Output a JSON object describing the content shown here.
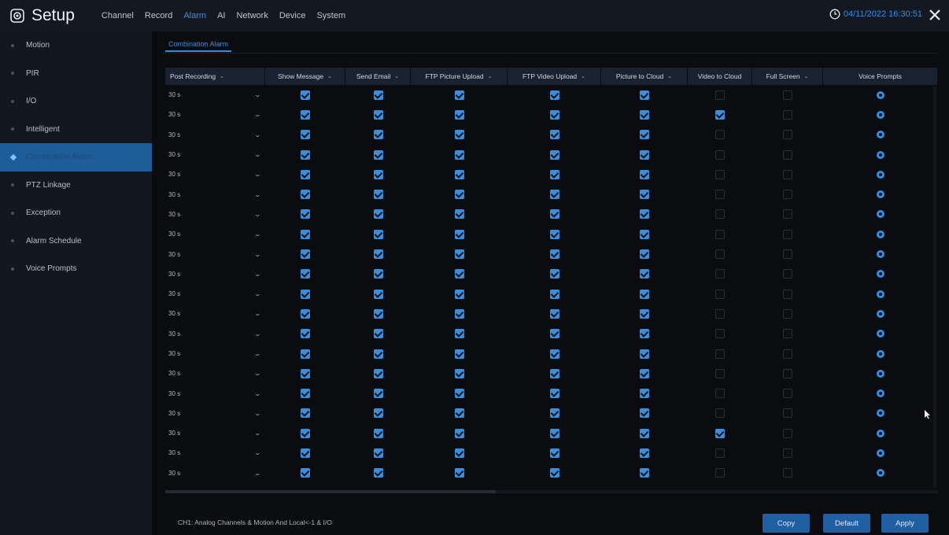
{
  "app": {
    "title": "Setup",
    "datetime": "04/11/2022 16:30:51"
  },
  "menu": [
    {
      "label": "Channel",
      "active": false
    },
    {
      "label": "Record",
      "active": false
    },
    {
      "label": "Alarm",
      "active": true
    },
    {
      "label": "AI",
      "active": false
    },
    {
      "label": "Network",
      "active": false
    },
    {
      "label": "Device",
      "active": false
    },
    {
      "label": "System",
      "active": false
    }
  ],
  "sidebar": {
    "items": [
      {
        "label": "Motion",
        "active": false
      },
      {
        "label": "PIR",
        "active": false
      },
      {
        "label": "I/O",
        "active": false
      },
      {
        "label": "Intelligent",
        "active": false
      },
      {
        "label": "Combination Alarm",
        "active": true
      },
      {
        "label": "PTZ Linkage",
        "active": false
      },
      {
        "label": "Exception",
        "active": false
      },
      {
        "label": "Alarm Schedule",
        "active": false
      },
      {
        "label": "Voice Prompts",
        "active": false
      }
    ]
  },
  "subtab": {
    "label": "Combination Alarm"
  },
  "table": {
    "headers": [
      {
        "label": "Post Recording",
        "caret": true
      },
      {
        "label": "Show Message",
        "caret": true
      },
      {
        "label": "Send Email",
        "caret": true
      },
      {
        "label": "FTP Picture Upload",
        "caret": true
      },
      {
        "label": "FTP Video Upload",
        "caret": true
      },
      {
        "label": "Picture to Cloud",
        "caret": true
      },
      {
        "label": "Video to Cloud",
        "caret": false
      },
      {
        "label": "Full Screen",
        "caret": true
      },
      {
        "label": "Voice Prompts",
        "caret": false
      }
    ],
    "rows": [
      {
        "post": "30 s",
        "show": true,
        "email": true,
        "ftp_pic": true,
        "ftp_vid": true,
        "pic_cloud": true,
        "vid_cloud": false,
        "full": false
      },
      {
        "post": "30 s",
        "show": true,
        "email": true,
        "ftp_pic": true,
        "ftp_vid": true,
        "pic_cloud": true,
        "vid_cloud": true,
        "full": false
      },
      {
        "post": "30 s",
        "show": true,
        "email": true,
        "ftp_pic": true,
        "ftp_vid": true,
        "pic_cloud": true,
        "vid_cloud": false,
        "full": false
      },
      {
        "post": "30 s",
        "show": true,
        "email": true,
        "ftp_pic": true,
        "ftp_vid": true,
        "pic_cloud": true,
        "vid_cloud": false,
        "full": false
      },
      {
        "post": "30 s",
        "show": true,
        "email": true,
        "ftp_pic": true,
        "ftp_vid": true,
        "pic_cloud": true,
        "vid_cloud": false,
        "full": false
      },
      {
        "post": "30 s",
        "show": true,
        "email": true,
        "ftp_pic": true,
        "ftp_vid": true,
        "pic_cloud": true,
        "vid_cloud": false,
        "full": false
      },
      {
        "post": "30 s",
        "show": true,
        "email": true,
        "ftp_pic": true,
        "ftp_vid": true,
        "pic_cloud": true,
        "vid_cloud": false,
        "full": false
      },
      {
        "post": "30 s",
        "show": true,
        "email": true,
        "ftp_pic": true,
        "ftp_vid": true,
        "pic_cloud": true,
        "vid_cloud": false,
        "full": false
      },
      {
        "post": "30 s",
        "show": true,
        "email": true,
        "ftp_pic": true,
        "ftp_vid": true,
        "pic_cloud": true,
        "vid_cloud": false,
        "full": false
      },
      {
        "post": "30 s",
        "show": true,
        "email": true,
        "ftp_pic": true,
        "ftp_vid": true,
        "pic_cloud": true,
        "vid_cloud": false,
        "full": false
      },
      {
        "post": "30 s",
        "show": true,
        "email": true,
        "ftp_pic": true,
        "ftp_vid": true,
        "pic_cloud": true,
        "vid_cloud": false,
        "full": false
      },
      {
        "post": "30 s",
        "show": true,
        "email": true,
        "ftp_pic": true,
        "ftp_vid": true,
        "pic_cloud": true,
        "vid_cloud": false,
        "full": false
      },
      {
        "post": "30 s",
        "show": true,
        "email": true,
        "ftp_pic": true,
        "ftp_vid": true,
        "pic_cloud": true,
        "vid_cloud": false,
        "full": false
      },
      {
        "post": "30 s",
        "show": true,
        "email": true,
        "ftp_pic": true,
        "ftp_vid": true,
        "pic_cloud": true,
        "vid_cloud": false,
        "full": false
      },
      {
        "post": "30 s",
        "show": true,
        "email": true,
        "ftp_pic": true,
        "ftp_vid": true,
        "pic_cloud": true,
        "vid_cloud": false,
        "full": false
      },
      {
        "post": "30 s",
        "show": true,
        "email": true,
        "ftp_pic": true,
        "ftp_vid": true,
        "pic_cloud": true,
        "vid_cloud": false,
        "full": false
      },
      {
        "post": "30 s",
        "show": true,
        "email": true,
        "ftp_pic": true,
        "ftp_vid": true,
        "pic_cloud": true,
        "vid_cloud": false,
        "full": false
      },
      {
        "post": "30 s",
        "show": true,
        "email": true,
        "ftp_pic": true,
        "ftp_vid": true,
        "pic_cloud": true,
        "vid_cloud": true,
        "full": false
      },
      {
        "post": "30 s",
        "show": true,
        "email": true,
        "ftp_pic": true,
        "ftp_vid": true,
        "pic_cloud": true,
        "vid_cloud": false,
        "full": false
      },
      {
        "post": "30 s",
        "show": true,
        "email": true,
        "ftp_pic": true,
        "ftp_vid": true,
        "pic_cloud": true,
        "vid_cloud": false,
        "full": false
      }
    ]
  },
  "footer": {
    "note": "CH1: Analog Channels & Motion And Local<-1 & I/O",
    "copy_label": "Copy",
    "default_label": "Default",
    "apply_label": "Apply"
  },
  "colors": {
    "accent": "#2f8fe6",
    "button": "#1f5fa2",
    "sidebar_active": "#1e5d99"
  },
  "icons": [
    "setup-gear-icon",
    "clock-icon",
    "close-icon",
    "chevron-down-icon",
    "checkbox-icon",
    "voice-settings-icon",
    "mouse-pointer-icon"
  ]
}
